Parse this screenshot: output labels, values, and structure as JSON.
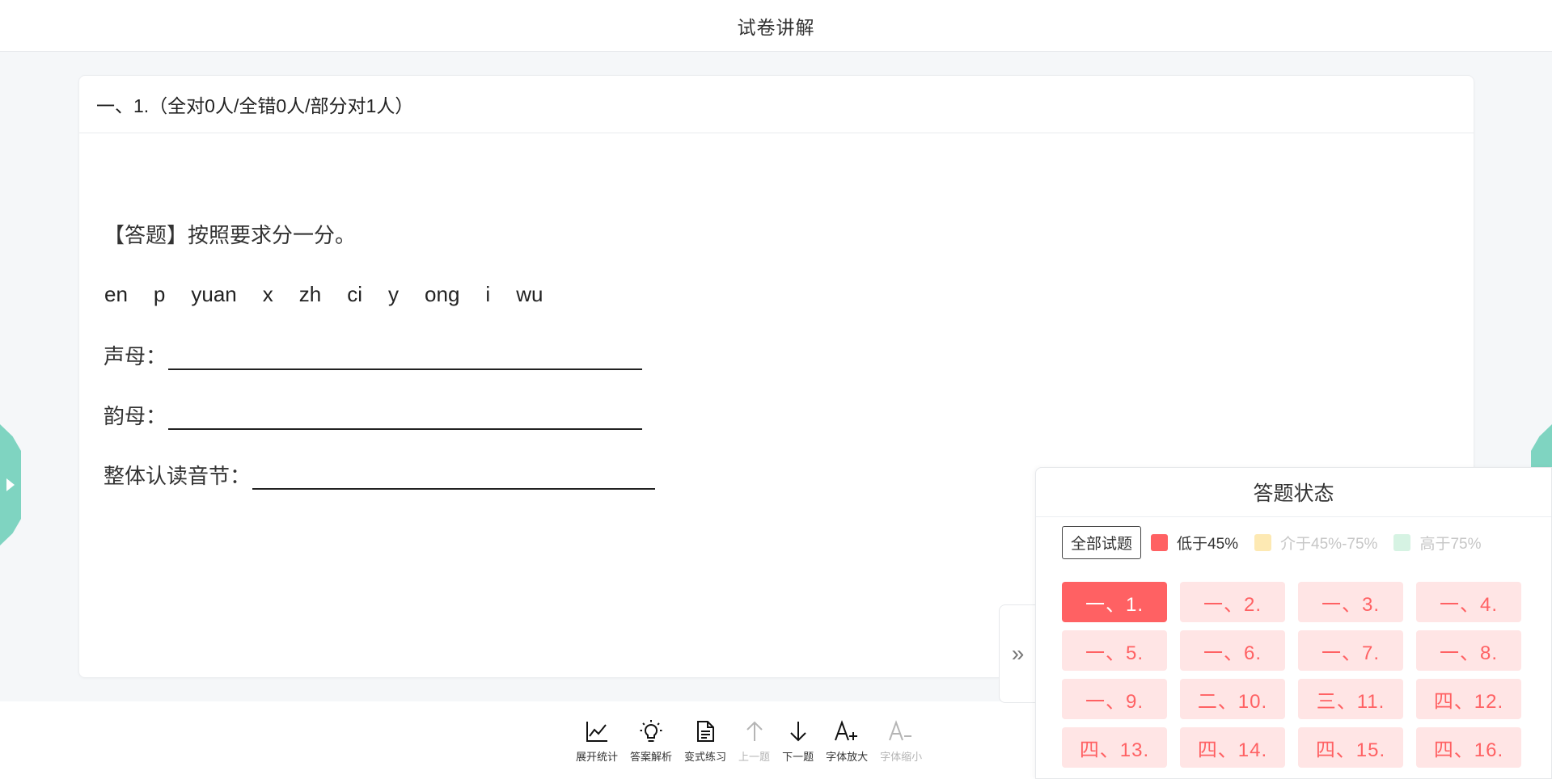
{
  "header": {
    "title": "试卷讲解"
  },
  "question": {
    "heading": "一、1.（全对0人/全错0人/部分对1人）",
    "prompt": "【答题】按照要求分一分。",
    "pinyin": [
      "en",
      "p",
      "yuan",
      "x",
      "zh",
      "ci",
      "y",
      "ong",
      "i",
      "wu"
    ],
    "blanks": [
      {
        "label": "声母："
      },
      {
        "label": "韵母："
      },
      {
        "label": "整体认读音节："
      }
    ]
  },
  "status_panel": {
    "title": "答题状态",
    "filter_all": "全部试题",
    "legend": [
      {
        "label": "低于45%",
        "color": "#ff6163",
        "state": "active"
      },
      {
        "label": "介于45%-75%",
        "color": "#fde9b3",
        "state": "dim"
      },
      {
        "label": "高于75%",
        "color": "#d6f3e3",
        "state": "dim"
      }
    ],
    "questions": [
      "一、1.",
      "一、2.",
      "一、3.",
      "一、4.",
      "一、5.",
      "一、6.",
      "一、7.",
      "一、8.",
      "一、9.",
      "二、10.",
      "三、11.",
      "四、12.",
      "四、13.",
      "四、14.",
      "四、15.",
      "四、16."
    ],
    "active_index": 0,
    "collapse_icon": "double-chevron-right-icon"
  },
  "toolbar": {
    "items": [
      {
        "label": "展开统计",
        "icon": "line-chart-icon",
        "disabled": false
      },
      {
        "label": "答案解析",
        "icon": "lightbulb-icon",
        "disabled": false
      },
      {
        "label": "变式练习",
        "icon": "document-icon",
        "disabled": false
      },
      {
        "label": "上一题",
        "icon": "arrow-up-icon",
        "disabled": true
      },
      {
        "label": "下一题",
        "icon": "arrow-down-icon",
        "disabled": false
      },
      {
        "label": "字体放大",
        "icon": "font-increase-icon",
        "disabled": false
      },
      {
        "label": "字体缩小",
        "icon": "font-decrease-icon",
        "disabled": true
      }
    ]
  },
  "colors": {
    "accent": "#ff6163",
    "accent_light": "#ffe5e5",
    "side_tab": "#7fd4c1"
  }
}
